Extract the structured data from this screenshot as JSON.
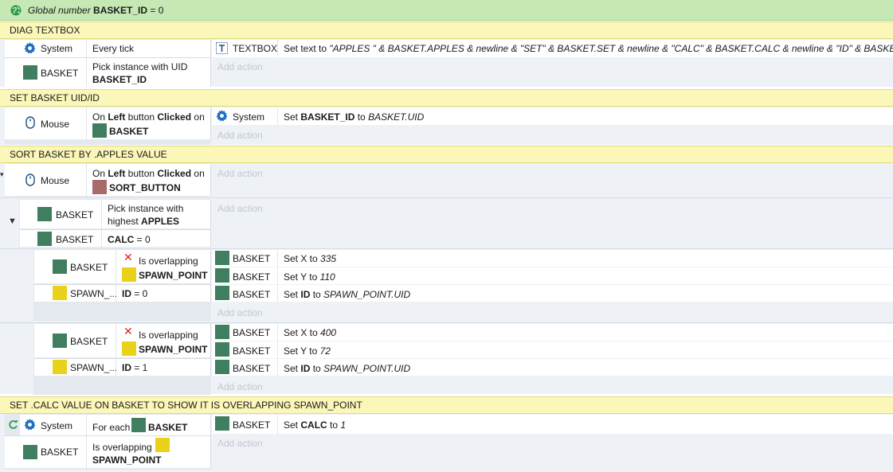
{
  "global_var": {
    "prefix": "Global number ",
    "name": "BASKET_ID",
    "suffix": " = 0"
  },
  "groups": {
    "diag": "DIAG TEXTBOX",
    "setuid": "SET BASKET UID/ID",
    "sort": "SORT BASKET BY .APPLES VALUE",
    "setcalc": "SET .CALC VALUE ON BASKET TO SHOW IT IS OVERLAPPING SPAWN_POINT"
  },
  "objects": {
    "system": "System",
    "basket": "BASKET",
    "mouse": "Mouse",
    "textbox": "TEXTBOX",
    "spawn_short": "SPAWN_...",
    "spawn_point": "SPAWN_POINT",
    "sort_button": "SORT_BUTTON"
  },
  "text": {
    "every_tick": "Every tick",
    "pick_uid": "Pick instance with UID",
    "basket_id": "BASKET_ID",
    "on": "On ",
    "left": "Left",
    "button": " button ",
    "clicked": "Clicked",
    "on_after": " on",
    "pick_highest": "Pick instance with",
    "highest": "highest ",
    "apples": "APPLES",
    "calc": "CALC",
    "eq0": " = 0",
    "is_overlapping": "Is overlapping",
    "id": "ID",
    "eq1": " = 1",
    "for_each": "For each ",
    "add_action": "Add action",
    "set_text_prefix": "Set text to ",
    "set_text_expr": "\"APPLES \" & BASKET.APPLES & newline & \"SET\" & BASKET.SET & newline & \"CALC\" & BASKET.CALC & newline & \"ID\" & BASKET_ID",
    "set": "Set ",
    "to": " to ",
    "basket_uid": "BASKET.UID",
    "set_x": "Set X to ",
    "set_y": "Set Y to ",
    "v335": "335",
    "v110": "110",
    "v400": "400",
    "v72": "72",
    "spawn_uid": "SPAWN_POINT.UID",
    "calc_label": "CALC",
    "v1": "1"
  },
  "colors": {
    "variable_bar": "#c6e8b4",
    "group_bar": "#fbf7b8",
    "basket": "#3f7f5f",
    "spawn": "#e8d21c",
    "sort_button": "#a86a6a"
  }
}
